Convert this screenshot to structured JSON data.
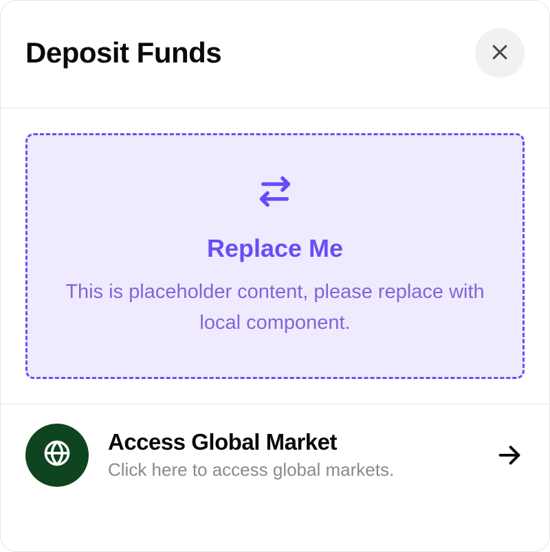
{
  "header": {
    "title": "Deposit Funds"
  },
  "placeholder": {
    "title": "Replace Me",
    "description": "This is placeholder content, please replace with local component."
  },
  "footer": {
    "title": "Access Global Market",
    "subtitle": "Click here to access global markets."
  },
  "icons": {
    "close": "close-icon",
    "swap": "swap-icon",
    "globe": "globe-icon",
    "arrow_right": "arrow-right-icon"
  },
  "colors": {
    "accent": "#6a4cf5",
    "accent_bg": "#efeafe",
    "globe_bg": "#0f4421"
  }
}
